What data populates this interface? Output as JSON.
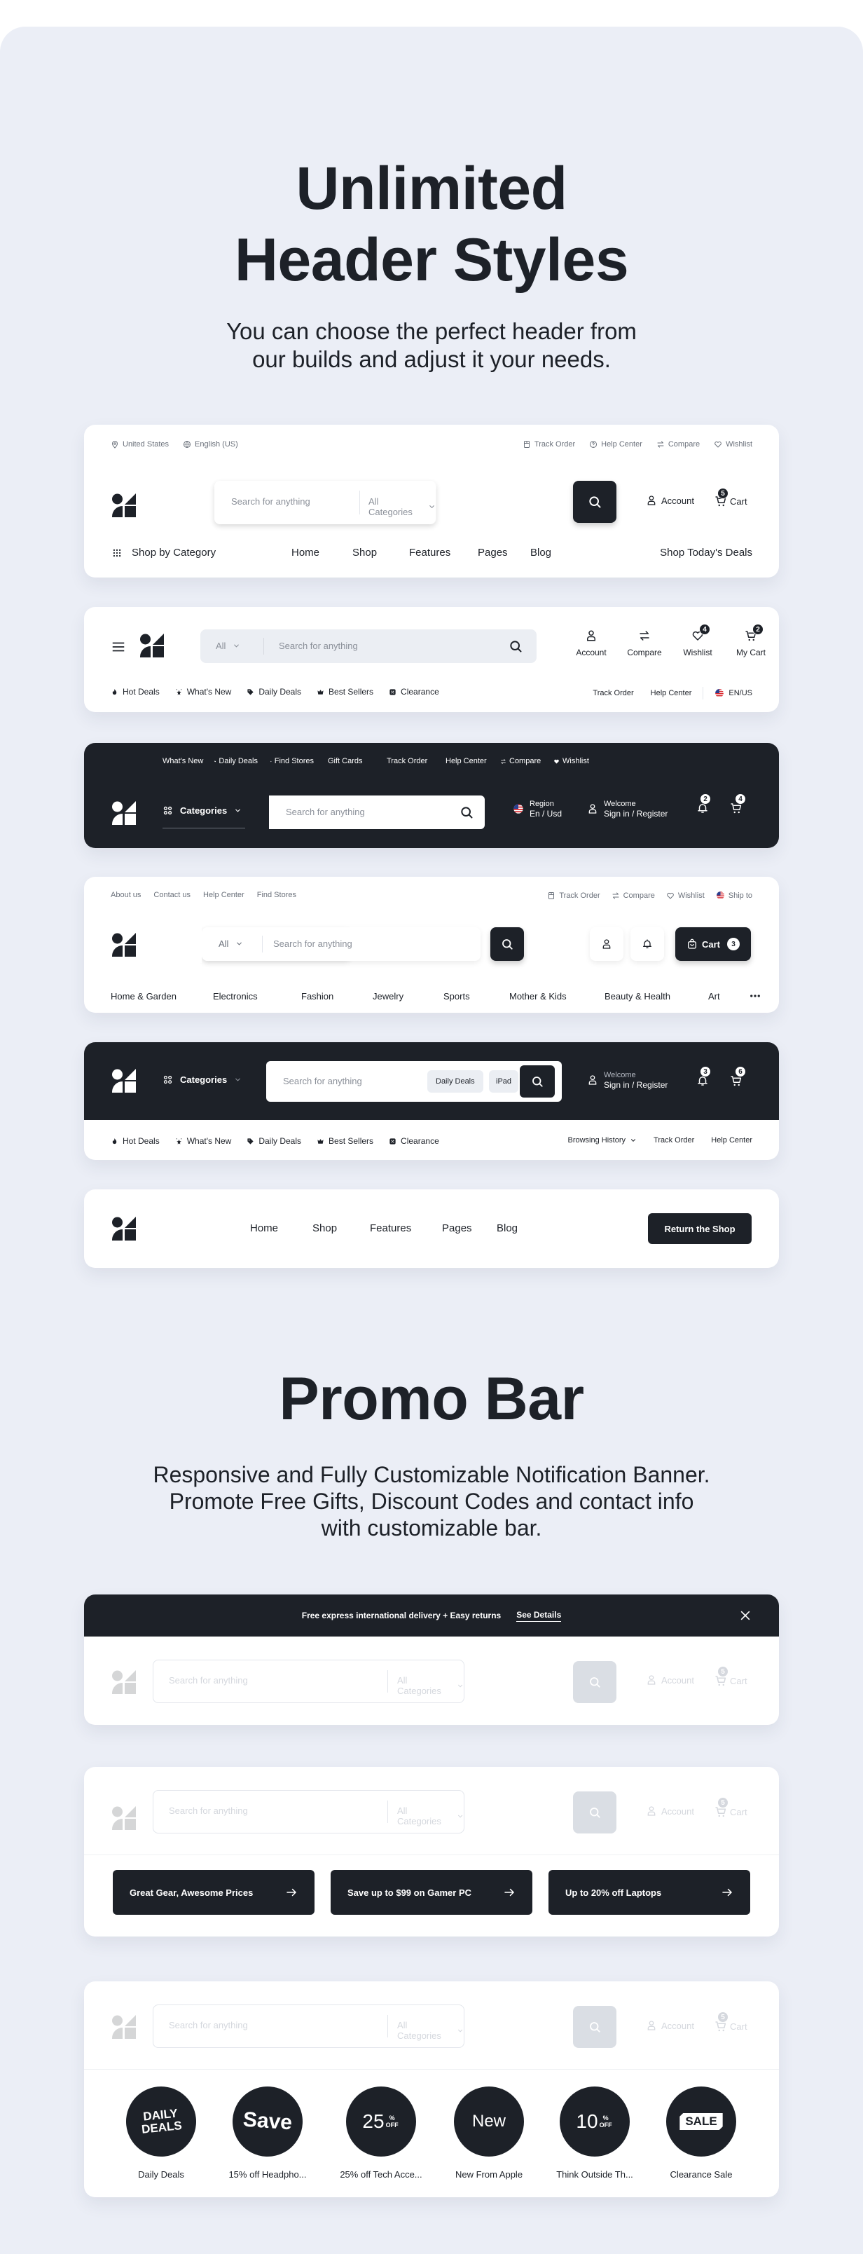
{
  "section1": {
    "title_line1": "Unlimited",
    "title_line2": "Header Styles",
    "subtitle_line1": "You can choose the perfect header from",
    "subtitle_line2": "our builds and adjust it your needs."
  },
  "header1": {
    "top_left": [
      {
        "icon": "map-pin-icon",
        "label": "United States"
      },
      {
        "icon": "globe-icon",
        "label": "English (US)"
      }
    ],
    "top_right": [
      {
        "icon": "box-icon",
        "label": "Track Order"
      },
      {
        "icon": "help-circle-icon",
        "label": "Help Center"
      },
      {
        "icon": "compare-arrows-icon",
        "label": "Compare"
      },
      {
        "icon": "heart-icon",
        "label": "Wishlist"
      }
    ],
    "search_placeholder": "Search for anything",
    "category_select": "All Categories",
    "account_label": "Account",
    "cart_label": "Cart",
    "cart_count": "5",
    "shop_by_category": "Shop by Category",
    "nav": [
      "Home",
      "Shop",
      "Features",
      "Pages",
      "Blog"
    ],
    "deals_link": "Shop Today's Deals"
  },
  "header2": {
    "select_all": "All",
    "search_placeholder": "Search for anything",
    "actions": [
      {
        "icon": "user-icon",
        "label": "Account",
        "badge": null
      },
      {
        "icon": "compare-arrows-icon",
        "label": "Compare",
        "badge": null
      },
      {
        "icon": "heart-icon",
        "label": "Wishlist",
        "badge": "4"
      },
      {
        "icon": "cart-icon",
        "label": "My Cart",
        "badge": "2"
      }
    ],
    "bottom_left": [
      {
        "icon": "fire-icon",
        "label": "Hot Deals"
      },
      {
        "icon": "sparkle-icon",
        "label": "What's New"
      },
      {
        "icon": "tag-icon",
        "label": "Daily Deals"
      },
      {
        "icon": "crown-icon",
        "label": "Best Sellers"
      },
      {
        "icon": "percent-icon",
        "label": "Clearance"
      }
    ],
    "bottom_right": [
      "Track Order",
      "Help Center"
    ],
    "locale": "EN/US"
  },
  "header3": {
    "top_links": [
      {
        "icon": "star-icon",
        "label": "What's New"
      },
      {
        "icon": "tag-icon",
        "label": "Daily Deals"
      },
      {
        "icon": "map-pin-icon",
        "label": "Find Stores"
      },
      {
        "icon": null,
        "label": "Gift Cards"
      },
      {
        "icon": null,
        "label": "Track Order"
      },
      {
        "icon": null,
        "label": "Help Center"
      },
      {
        "icon": "compare-arrows-icon",
        "label": "Compare"
      },
      {
        "icon": "heart-icon",
        "label": "Wishlist"
      }
    ],
    "categories_label": "Categories",
    "search_placeholder": "Search for anything",
    "region_label": "Region",
    "region_value": "En / Usd",
    "welcome_label": "Welcome",
    "signin_label": "Sign in / Register",
    "notif_count": "2",
    "cart_count": "4"
  },
  "header4": {
    "top_left": [
      "About us",
      "Contact us",
      "Help Center",
      "Find Stores"
    ],
    "top_right": [
      {
        "icon": "box-icon",
        "label": "Track Order"
      },
      {
        "icon": "compare-arrows-icon",
        "label": "Compare"
      },
      {
        "icon": "heart-icon",
        "label": "Wishlist"
      },
      {
        "icon": "us-flag-icon",
        "label": "Ship to"
      }
    ],
    "select_all": "All",
    "search_placeholder": "Search for anything",
    "cart_label": "Cart",
    "cart_count": "3",
    "categories": [
      "Home & Garden",
      "Electronics",
      "Fashion",
      "Jewelry",
      "Sports",
      "Mother & Kids",
      "Beauty & Health",
      "Art"
    ]
  },
  "header5": {
    "categories_label": "Categories",
    "search_placeholder": "Search for anything",
    "chips": [
      "Daily Deals",
      "iPad"
    ],
    "welcome_label": "Welcome",
    "signin_label": "Sign in / Register",
    "notif_count": "3",
    "cart_count": "6",
    "bottom_left": [
      {
        "icon": "fire-icon",
        "label": "Hot Deals"
      },
      {
        "icon": "sparkle-icon",
        "label": "What's New"
      },
      {
        "icon": "tag-icon",
        "label": "Daily Deals"
      },
      {
        "icon": "crown-icon",
        "label": "Best Sellers"
      },
      {
        "icon": "percent-icon",
        "label": "Clearance"
      }
    ],
    "browsing_history": "Browsing History",
    "bottom_right": [
      "Track Order",
      "Help Center"
    ]
  },
  "header6": {
    "nav": [
      "Home",
      "Shop",
      "Features",
      "Pages",
      "Blog"
    ],
    "cta": "Return the Shop"
  },
  "section2": {
    "title": "Promo Bar",
    "subtitle_line1": "Responsive and Fully Customizable Notification Banner.",
    "subtitle_line2": "Promote Free Gifts, Discount Codes and contact info",
    "subtitle_line3": "with customizable bar."
  },
  "promo1": {
    "message": "Free express international delivery + Easy returns",
    "link": "See Details"
  },
  "faded_header": {
    "search_placeholder": "Search for anything",
    "category_select": "All Categories",
    "account_label": "Account",
    "cart_label": "Cart",
    "cart_count": "5"
  },
  "promo2": {
    "buttons": [
      "Great Gear, Awesome Prices",
      "Save up to $99 on Gamer PC",
      "Up to 20% off Laptops"
    ]
  },
  "promo3": {
    "items": [
      {
        "badge_line1": "DAILY",
        "badge_line2": "DEALS",
        "label": "Daily Deals"
      },
      {
        "badge_line1": "Save",
        "badge_line2": "",
        "label": "15% off Headpho..."
      },
      {
        "badge_line1": "25",
        "badge_line2": "% OFF",
        "label": "25% off Tech Acce..."
      },
      {
        "badge_line1": "New",
        "badge_line2": "",
        "label": "New From Apple"
      },
      {
        "badge_line1": "10",
        "badge_line2": "% OFF",
        "label": "Think Outside Th..."
      },
      {
        "badge_line1": "SALE",
        "badge_line2": "",
        "label": "Clearance Sale"
      }
    ]
  }
}
